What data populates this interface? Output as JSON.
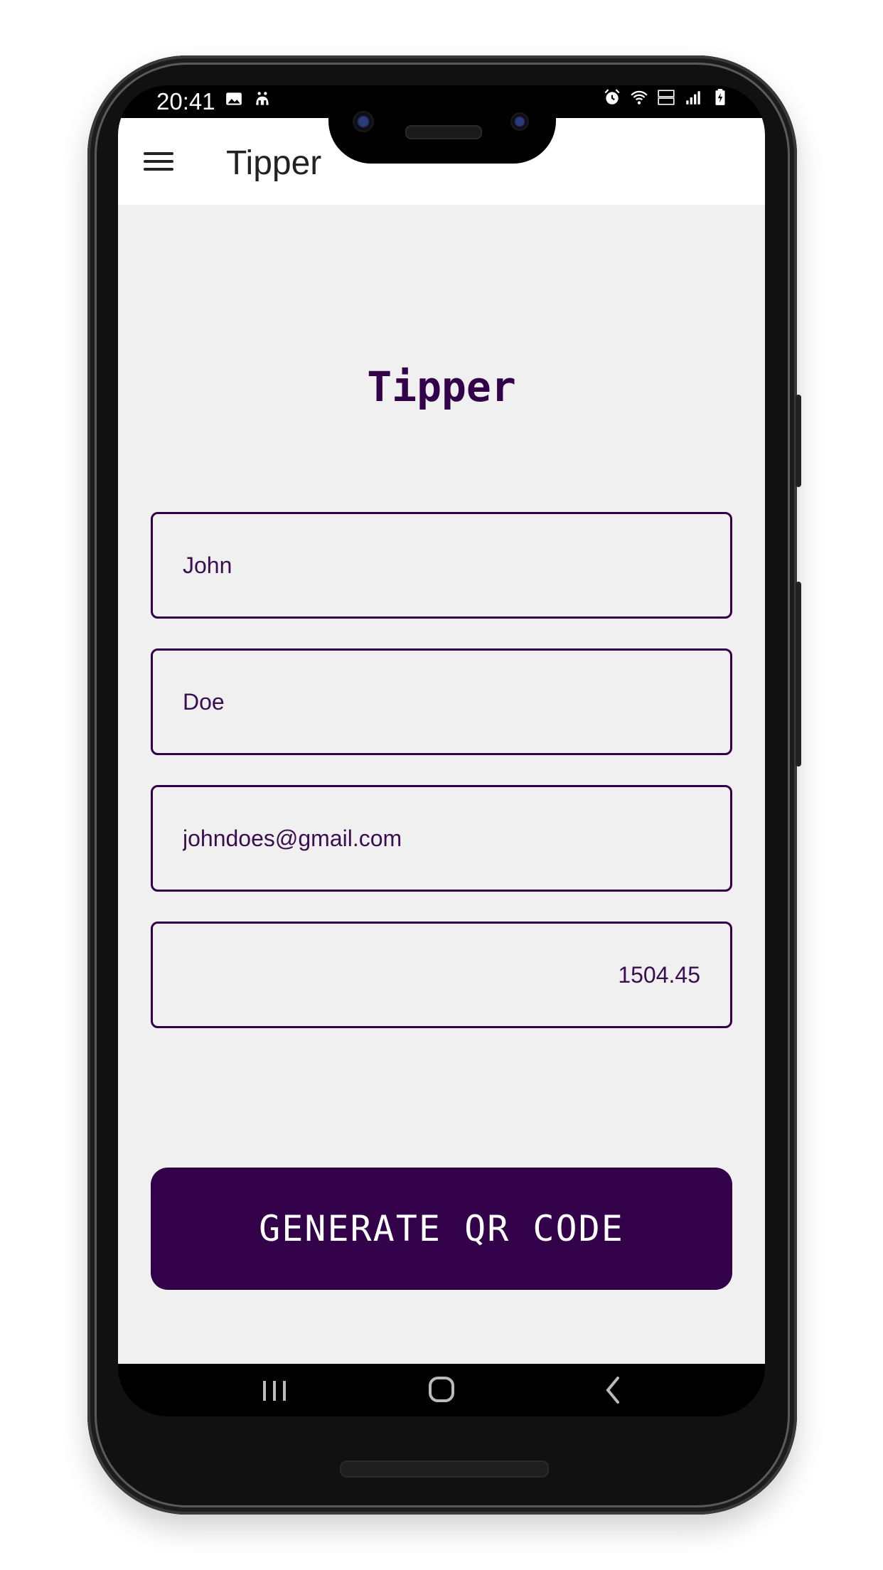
{
  "status_bar": {
    "time": "20:41",
    "left_icons": [
      "image-icon",
      "notification-icon"
    ],
    "right_icons": [
      "alarm-icon",
      "wifi-icon",
      "volte-icon",
      "signal-icon",
      "battery-charging-icon"
    ],
    "volte_label": "VoLTE"
  },
  "app_bar": {
    "title": "Tipper",
    "menu_icon": "hamburger-menu-icon"
  },
  "form": {
    "heading": "Tipper",
    "first_name": "John",
    "last_name": "Doe",
    "email": "johndoes@gmail.com",
    "amount": "1504.45",
    "generate_label": "GENERATE QR CODE"
  },
  "nav_bar": {
    "icons": [
      "recent-apps-icon",
      "home-icon",
      "back-icon"
    ]
  },
  "colors": {
    "primary": "#33004a",
    "background": "#f1f0f1",
    "app_bar": "#ffffff"
  }
}
